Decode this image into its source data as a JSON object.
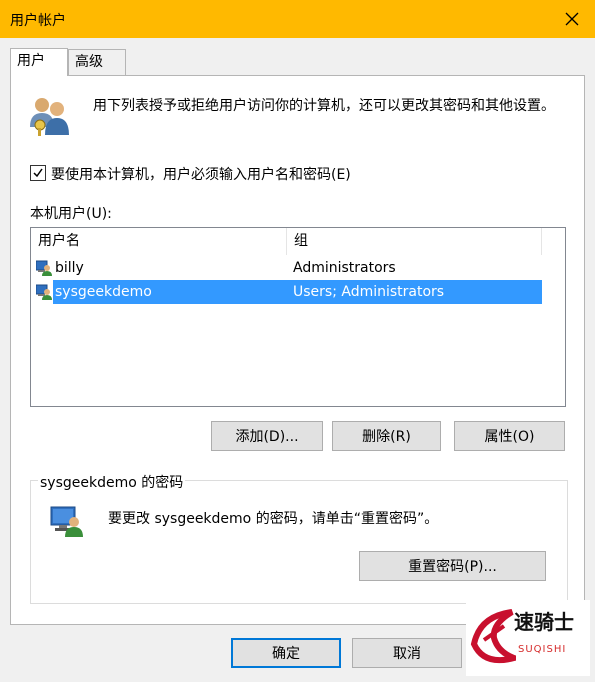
{
  "window": {
    "title": "用户帐户"
  },
  "tabs": [
    {
      "label": "用户"
    },
    {
      "label": "高级"
    }
  ],
  "intro": {
    "text": "用下列表授予或拒绝用户访问你的计算机，还可以更改其密码和其他设置。"
  },
  "require_password": {
    "checked": true,
    "label": "要使用本计算机，用户必须输入用户名和密码(E)"
  },
  "users_list": {
    "label": "本机用户(U):",
    "columns": [
      "用户名",
      "组"
    ],
    "rows": [
      {
        "name": "billy",
        "group": "Administrators",
        "selected": false
      },
      {
        "name": "sysgeekdemo",
        "group": "Users; Administrators",
        "selected": true
      }
    ]
  },
  "buttons": {
    "add": "添加(D)...",
    "remove": "删除(R)",
    "properties": "属性(O)"
  },
  "password_group": {
    "title": "sysgeekdemo 的密码",
    "text": "要更改 sysgeekdemo 的密码，请单击“重置密码”。",
    "reset_button": "重置密码(P)..."
  },
  "footer": {
    "ok": "确定",
    "cancel": "取消"
  },
  "watermark": {
    "brand": "速骑士",
    "sub": "SUQISHI"
  },
  "colors": {
    "titlebar": "#ffb900",
    "selection": "#3399ff",
    "default_button_border": "#0078d7"
  }
}
